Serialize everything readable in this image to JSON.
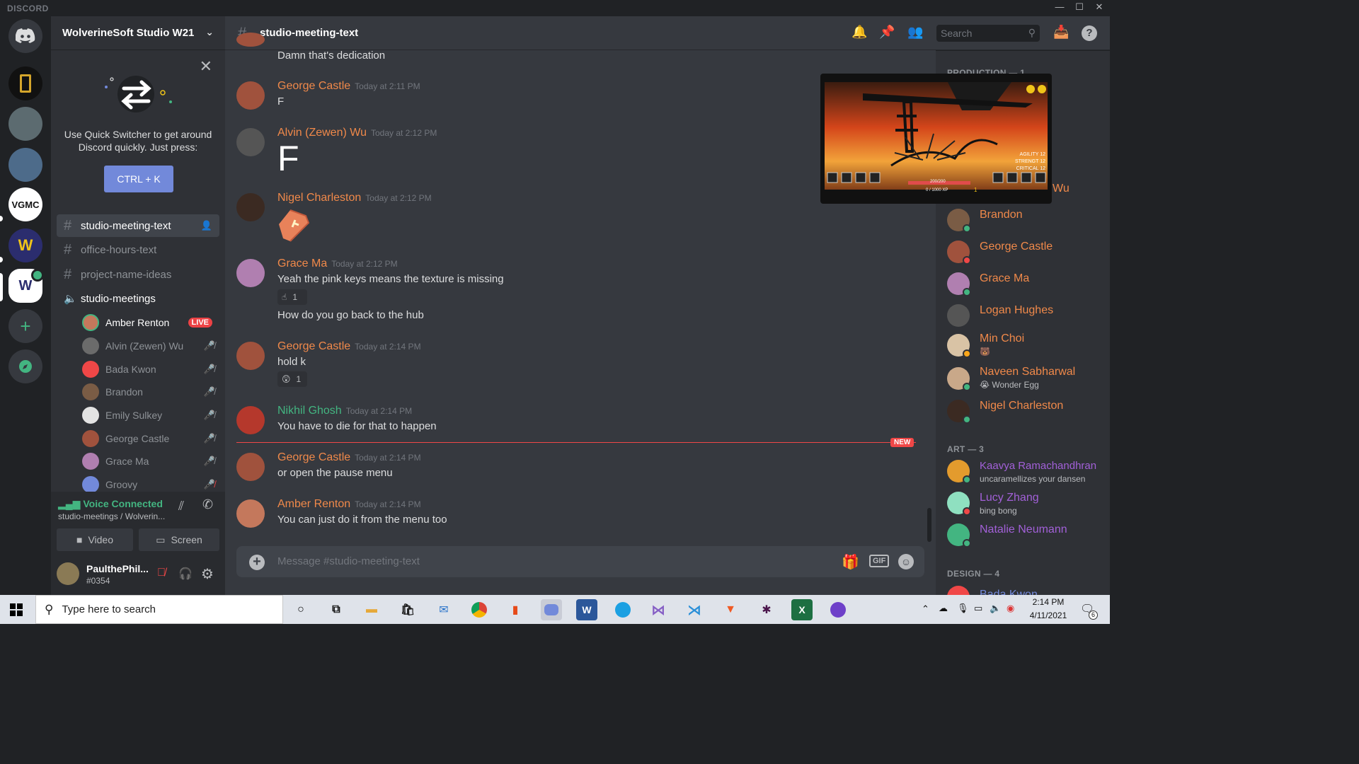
{
  "window": {
    "brand": "DISCORD"
  },
  "server": {
    "name": "WolverineSoft Studio W21"
  },
  "quick_switcher": {
    "text": "Use Quick Switcher to get around Discord quickly. Just press:",
    "shortcut": "CTRL + K"
  },
  "channels": [
    {
      "name": "studio-meeting-text",
      "type": "text",
      "active": true
    },
    {
      "name": "office-hours-text",
      "type": "text"
    },
    {
      "name": "project-name-ideas",
      "type": "text"
    },
    {
      "name": "studio-meetings",
      "type": "voice"
    }
  ],
  "voice_users": [
    {
      "name": "Amber Renton",
      "badge": "LIVE",
      "color": "#c4785c"
    },
    {
      "name": "Alvin (Zewen) Wu",
      "color": "#6b6b6b"
    },
    {
      "name": "Bada Kwon",
      "color": "#f04747"
    },
    {
      "name": "Brandon",
      "color": "#7a5c45"
    },
    {
      "name": "Emily Sulkey",
      "color": "#e3e3e3"
    },
    {
      "name": "George Castle",
      "color": "#a0523d"
    },
    {
      "name": "Grace Ma",
      "color": "#b07fb0"
    },
    {
      "name": "Groovy",
      "color": "#7289da"
    }
  ],
  "voice_panel": {
    "status": "Voice Connected",
    "location": "studio-meetings / Wolverin...",
    "video_label": "Video",
    "screen_label": "Screen"
  },
  "user": {
    "name": "PaulthePhil...",
    "tag": "#0354"
  },
  "header": {
    "channel": "studio-meeting-text",
    "search_placeholder": "Search"
  },
  "messages": [
    {
      "text_only": true,
      "text": "Damn that's dedication"
    },
    {
      "author": "George Castle",
      "time": "Today at 2:11 PM",
      "text": "F",
      "color": "#f0894a"
    },
    {
      "author": "Alvin (Zewen) Wu",
      "time": "Today at 2:12 PM",
      "text": "F",
      "color": "#f0894a",
      "big": true
    },
    {
      "author": "Nigel Charleston",
      "time": "Today at 2:12 PM",
      "text": "",
      "color": "#f0894a",
      "emoji": "coffin"
    },
    {
      "author": "Grace Ma",
      "time": "Today at 2:12 PM",
      "text": "Yeah the pink keys means the texture is missing",
      "color": "#f0894a",
      "reaction": {
        "emoji": "☝",
        "count": "1"
      },
      "followup": "How do you go back to the hub"
    },
    {
      "author": "George Castle",
      "time": "Today at 2:14 PM",
      "text": "hold k",
      "color": "#f0894a",
      "reaction": {
        "emoji": "😲",
        "count": "1"
      }
    },
    {
      "author": "Nikhil Ghosh",
      "time": "Today at 2:14 PM",
      "text": "You have to die for that to happen",
      "color": "#43b581"
    },
    {
      "author": "George Castle",
      "time": "Today at 2:14 PM",
      "text": "or open the pause menu",
      "color": "#f0894a"
    },
    {
      "author": "Amber Renton",
      "time": "Today at 2:14 PM",
      "text": "You can just do it from the menu too",
      "color": "#f0894a"
    }
  ],
  "new_divider": "NEW",
  "composer": {
    "placeholder": "Message #studio-meeting-text",
    "gif": "GIF"
  },
  "members": {
    "production": {
      "title": "PRODUCTION — 1",
      "partial_name": "Wu",
      "list": [
        {
          "name": "Brandon",
          "status": "online",
          "color": "#f0894a"
        },
        {
          "name": "George Castle",
          "status": "dnd",
          "color": "#f0894a"
        },
        {
          "name": "Grace Ma",
          "status": "online",
          "color": "#f0894a"
        },
        {
          "name": "Logan Hughes",
          "status": "",
          "color": "#f0894a"
        },
        {
          "name": "Min Choi",
          "status": "idle",
          "color": "#f0894a",
          "sub": "🐻"
        },
        {
          "name": "Naveen Sabharwal",
          "status": "online",
          "color": "#f0894a",
          "sub": "😭 Wonder Egg"
        },
        {
          "name": "Nigel Charleston",
          "status": "online",
          "color": "#f0894a"
        }
      ]
    },
    "art": {
      "title": "ART — 3",
      "list": [
        {
          "name": "Kaavya Ramachandhran",
          "status": "online",
          "color": "#a260d8",
          "sub": "uncaramellizes your dansen"
        },
        {
          "name": "Lucy Zhang",
          "status": "dnd",
          "color": "#a260d8",
          "sub": "bing bong"
        },
        {
          "name": "Natalie Neumann",
          "status": "online",
          "color": "#a260d8"
        }
      ]
    },
    "design": {
      "title": "DESIGN — 4",
      "first": "Bada Kwon"
    }
  },
  "stream_overlay": {
    "stats": [
      "AGILITY 12",
      "STRENGT 12",
      "CRITICAL 12"
    ],
    "hp": "200/200",
    "xp": "0 / 1000 XP",
    "level": "1"
  },
  "taskbar": {
    "search_placeholder": "Type here to search",
    "time": "2:14 PM",
    "date": "4/11/2021",
    "notif_count": "6"
  },
  "colors": {
    "blurple": "#7289da",
    "green": "#43b581",
    "red": "#f04747",
    "orange": "#f0894a"
  }
}
